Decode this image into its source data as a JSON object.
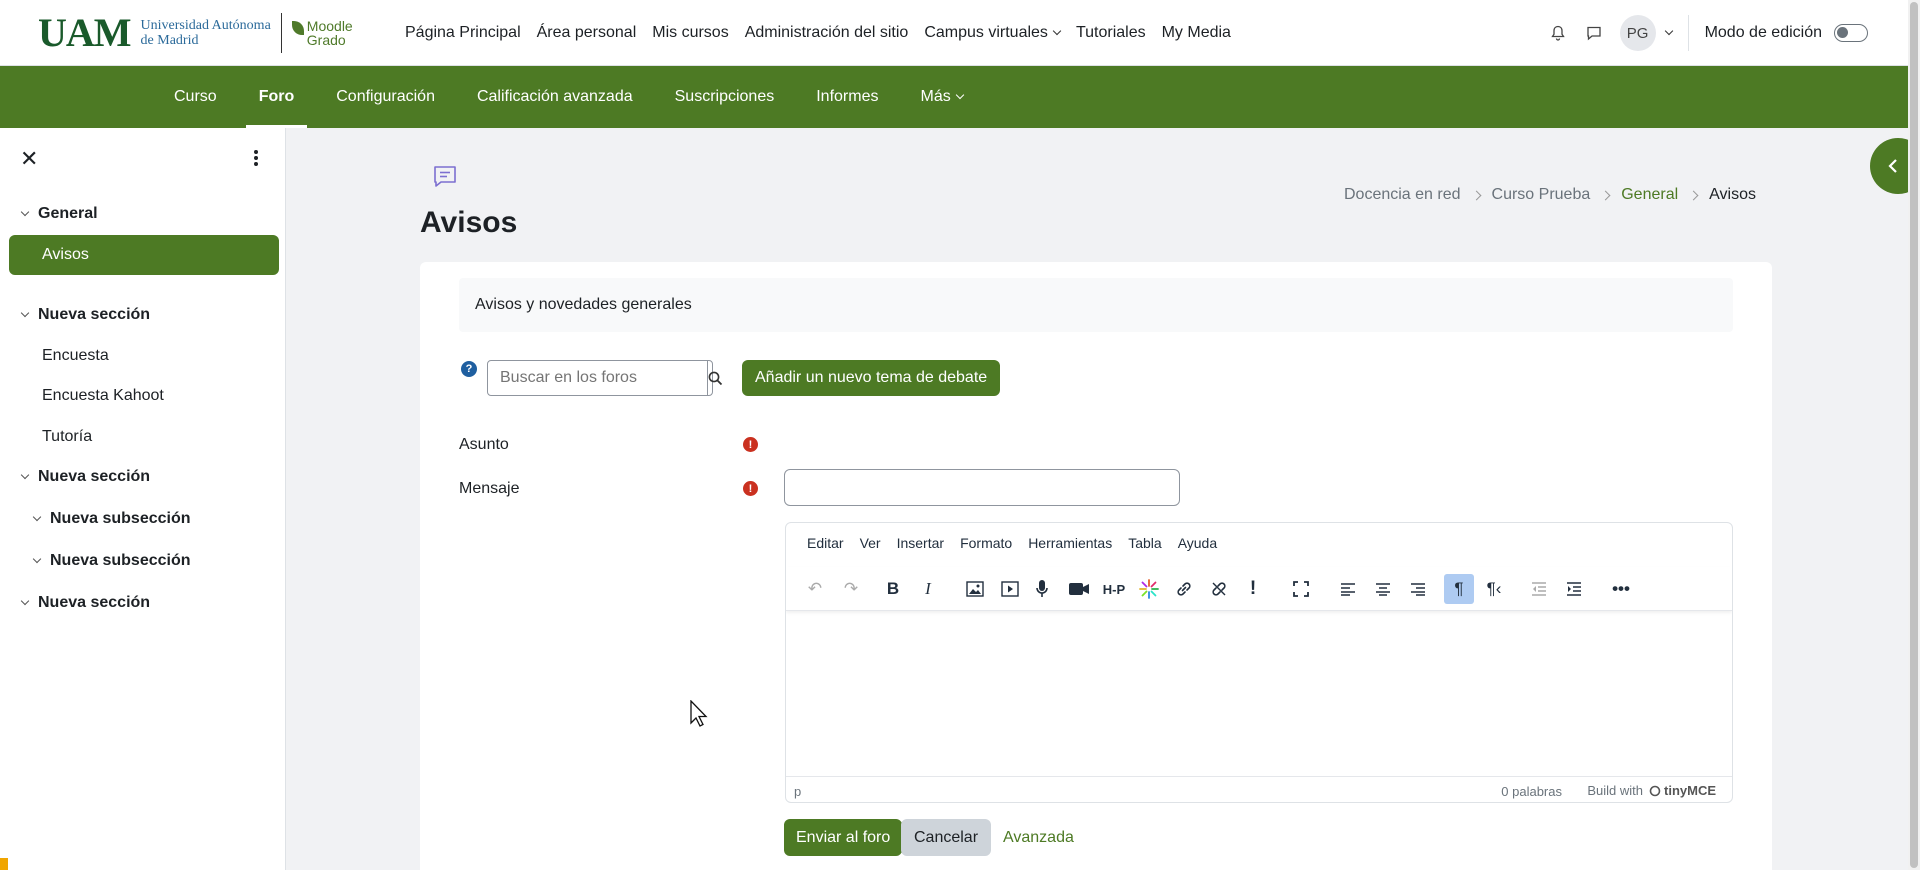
{
  "logo": {
    "mark": "UAM",
    "line1": "Universidad Autónoma",
    "line2": "de Madrid",
    "moodle1": "Moodle",
    "moodle2": "Grado"
  },
  "primary_nav": [
    "Página Principal",
    "Área personal",
    "Mis cursos",
    "Administración del sitio",
    "Campus virtuales",
    "Tutoriales",
    "My Media"
  ],
  "user": {
    "initials": "PG",
    "edit_mode_label": "Modo de edición"
  },
  "secondary_nav": {
    "items": [
      "Curso",
      "Foro",
      "Configuración",
      "Calificación avanzada",
      "Suscripciones",
      "Informes",
      "Más"
    ],
    "active": "Foro"
  },
  "sidebar": {
    "sections": [
      {
        "label": "General",
        "items": [
          "Avisos"
        ]
      },
      {
        "label": "Nueva sección",
        "items": [
          "Encuesta",
          "Encuesta Kahoot",
          "Tutoría"
        ]
      },
      {
        "label": "Nueva sección",
        "subsections": [
          "Nueva subsección",
          "Nueva subsección"
        ]
      },
      {
        "label": "Nueva sección"
      }
    ]
  },
  "page": {
    "title": "Avisos",
    "breadcrumb": [
      "Docencia en red",
      "Curso Prueba",
      "General",
      "Avisos"
    ]
  },
  "forum": {
    "intro": "Avisos y novedades generales",
    "search_placeholder": "Buscar en los foros",
    "add_button": "Añadir un nuevo tema de debate"
  },
  "form": {
    "subject_label": "Asunto",
    "message_label": "Mensaje",
    "subject_value": ""
  },
  "editor": {
    "menus": [
      "Editar",
      "Ver",
      "Insertar",
      "Formato",
      "Herramientas",
      "Tabla",
      "Ayuda"
    ],
    "status_path": "p",
    "word_count": "0 palabras",
    "build_with": "Build with",
    "brand": "tinyMCE"
  },
  "actions": {
    "submit": "Enviar al foro",
    "cancel": "Cancelar",
    "advanced": "Avanzada"
  },
  "colors": {
    "primary": "#4d7a24",
    "required": "#ca3120",
    "help": "#1f5fa0"
  }
}
